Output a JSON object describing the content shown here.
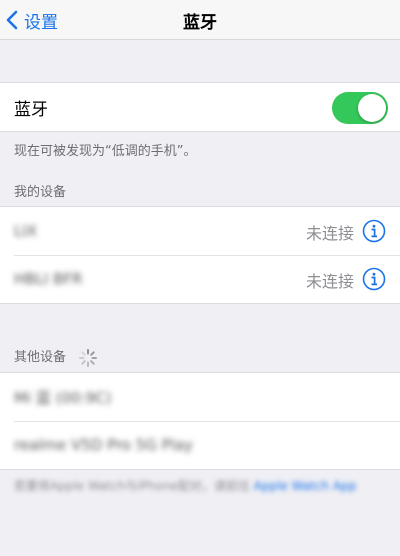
{
  "nav": {
    "back_label": "设置",
    "title": "蓝牙"
  },
  "bluetooth": {
    "label": "蓝牙",
    "enabled": true,
    "discoverable_note": "现在可被发现为“低调的手机”。"
  },
  "my_devices": {
    "section_label": "我的设备",
    "items": [
      {
        "name": "LIX",
        "status": "未连接"
      },
      {
        "name": "HBLI BFR",
        "status": "未连接"
      }
    ]
  },
  "other_devices": {
    "section_label": "其他设备",
    "items": [
      {
        "name": "Mi 蓝 (00:9C)"
      },
      {
        "name": "realme V5D Pro 5G Play"
      }
    ]
  },
  "footer": {
    "text": "若要将Apple Watch与iPhone配对，请前往",
    "link": "Apple Watch App"
  },
  "colors": {
    "accent": "#1a73e8",
    "toggle_on": "#34c759",
    "background": "#efeff4"
  },
  "icons": {
    "back": "chevron-left-icon",
    "info": "info-icon",
    "spinner": "activity-spinner-icon"
  }
}
